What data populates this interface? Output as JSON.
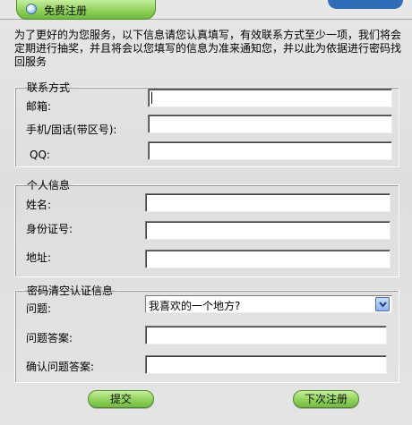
{
  "tab": {
    "title": "免费注册",
    "icon": "globe-icon"
  },
  "intro": "为了更好的为您服务，以下信息请您认真填写，有效联系方式至少一项，我们将会定期进行抽奖，并且将会以您填写的信息为准来通知您，并以此为依据进行密码找回服务",
  "contact": {
    "legend": "联系方式",
    "email_label": "邮箱:",
    "email_value": "",
    "phone_label": "手机/固话(带区号):",
    "phone_value": "",
    "qq_label": "QQ:",
    "qq_value": ""
  },
  "personal": {
    "legend": "个人信息",
    "name_label": "姓名:",
    "name_value": "",
    "id_label": "身份证号:",
    "id_value": "",
    "address_label": "地址:",
    "address_value": ""
  },
  "password": {
    "legend": "密码清空认证信息",
    "question_label": "问题:",
    "question_value": "我喜欢的一个地方?",
    "answer_label": "问题答案:",
    "answer_value": "",
    "confirm_label": "确认问题答案:",
    "confirm_value": ""
  },
  "buttons": {
    "submit": "提交",
    "later": "下次注册"
  },
  "colors": {
    "button_green": "#8fd25a",
    "tab_green": "#8ccf55",
    "top_blue": "#2f6cb8"
  }
}
